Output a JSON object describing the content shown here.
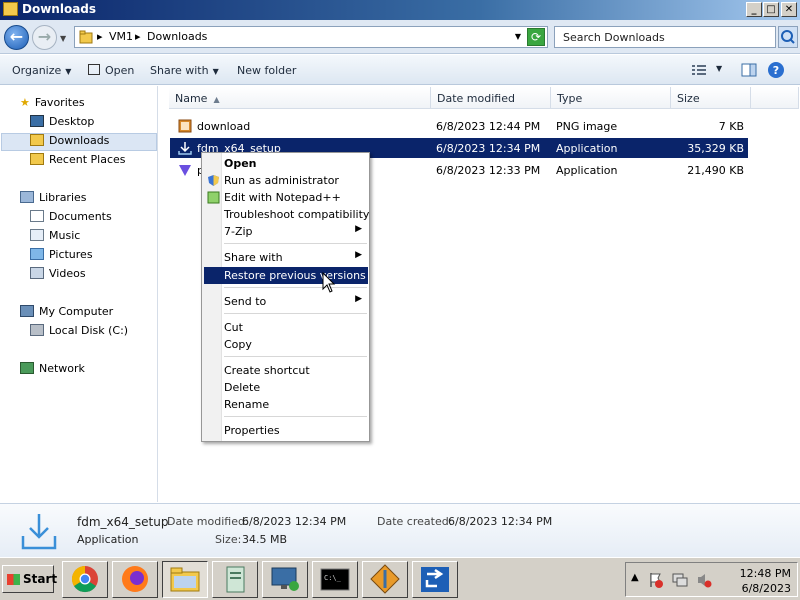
{
  "window": {
    "title": "Downloads"
  },
  "address": {
    "crumbs": [
      "VM1",
      "Downloads"
    ],
    "search_placeholder": "Search Downloads"
  },
  "toolbar": {
    "organize": "Organize",
    "open": "Open",
    "share_with": "Share with",
    "new_folder": "New folder"
  },
  "sidebar": {
    "favorites": "Favorites",
    "desktop": "Desktop",
    "downloads": "Downloads",
    "recent": "Recent Places",
    "libraries": "Libraries",
    "documents": "Documents",
    "music": "Music",
    "pictures": "Pictures",
    "videos": "Videos",
    "computer": "My Computer",
    "local_disk": "Local Disk (C:)",
    "network": "Network"
  },
  "columns": {
    "name": "Name",
    "date": "Date modified",
    "type": "Type",
    "size": "Size"
  },
  "files": [
    {
      "name": "download",
      "date": "6/8/2023 12:44 PM",
      "type": "PNG image",
      "size": "7 KB"
    },
    {
      "name": "fdm_x64_setup",
      "date": "6/8/2023 12:34 PM",
      "type": "Application",
      "size": "35,329 KB"
    },
    {
      "name": "p",
      "date": "6/8/2023 12:33 PM",
      "type": "Application",
      "size": "21,490 KB"
    }
  ],
  "context_menu": {
    "open": "Open",
    "run_admin": "Run as administrator",
    "edit_npp": "Edit with Notepad++",
    "troubleshoot": "Troubleshoot compatibility",
    "zip": "7-Zip",
    "share_with": "Share with",
    "restore": "Restore previous versions",
    "send_to": "Send to",
    "cut": "Cut",
    "copy": "Copy",
    "create_shortcut": "Create shortcut",
    "delete": "Delete",
    "rename": "Rename",
    "properties": "Properties"
  },
  "details": {
    "name": "fdm_x64_setup",
    "type": "Application",
    "modified_label": "Date modified:",
    "modified": "6/8/2023 12:34 PM",
    "created_label": "Date created:",
    "created": "6/8/2023 12:34 PM",
    "size_label": "Size:",
    "size": "34.5 MB"
  },
  "taskbar": {
    "start": "Start",
    "time": "12:48 PM",
    "date": "6/8/2023"
  },
  "colors": {
    "selection": "#0a246a",
    "title_start": "#0a246a",
    "toolbar": "#dde7f2"
  }
}
